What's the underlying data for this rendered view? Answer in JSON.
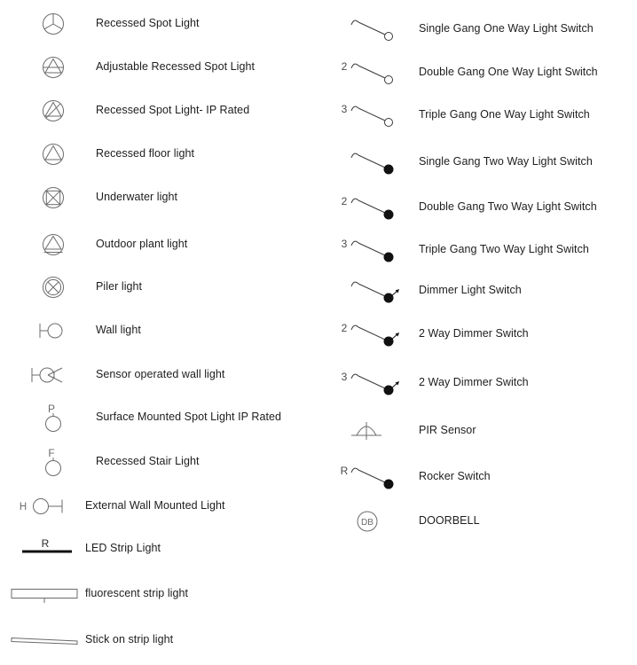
{
  "legend": {
    "left_column": [
      {
        "symbol": "recessed-spot-light",
        "label": "Recessed Spot Light"
      },
      {
        "symbol": "adjustable-recessed-spot-light",
        "label": "Adjustable Recessed Spot Light"
      },
      {
        "symbol": "recessed-spot-light-ip-rated",
        "label": "Recessed Spot Light- IP Rated"
      },
      {
        "symbol": "recessed-floor-light",
        "label": "Recessed floor light"
      },
      {
        "symbol": "underwater-light",
        "label": "Underwater light"
      },
      {
        "symbol": "outdoor-plant-light",
        "label": "Outdoor plant light"
      },
      {
        "symbol": "piler-light",
        "label": "Piler light"
      },
      {
        "symbol": "wall-light",
        "label": "Wall light"
      },
      {
        "symbol": "sensor-operated-wall-light",
        "label": "Sensor operated wall light"
      },
      {
        "symbol": "surface-mounted-spot-light-ip-rated",
        "label": "Surface Mounted Spot Light IP Rated",
        "marker": "P"
      },
      {
        "symbol": "recessed-stair-light",
        "label": "Recessed Stair Light",
        "marker": "F"
      },
      {
        "symbol": "external-wall-mounted-light",
        "label": "External Wall Mounted Light",
        "marker": "H"
      },
      {
        "symbol": "led-strip-light",
        "label": "LED Strip Light",
        "marker": "R"
      },
      {
        "symbol": "fluorescent-strip-light",
        "label": "fluorescent strip light"
      },
      {
        "symbol": "stick-on-strip-light",
        "label": "Stick on strip light"
      }
    ],
    "right_column": [
      {
        "symbol": "single-gang-one-way-switch",
        "label": "Single Gang One Way Light Switch",
        "marker": ""
      },
      {
        "symbol": "double-gang-one-way-switch",
        "label": "Double Gang One Way Light Switch",
        "marker": "2"
      },
      {
        "symbol": "triple-gang-one-way-switch",
        "label": "Triple Gang One Way Light Switch",
        "marker": "3"
      },
      {
        "symbol": "single-gang-two-way-switch",
        "label": "Single Gang Two Way Light Switch",
        "marker": ""
      },
      {
        "symbol": "double-gang-two-way-switch",
        "label": "Double Gang Two Way Light Switch",
        "marker": "2"
      },
      {
        "symbol": "triple-gang-two-way-switch",
        "label": "Triple Gang Two Way Light Switch",
        "marker": "3"
      },
      {
        "symbol": "dimmer-light-switch",
        "label": "Dimmer Light Switch",
        "marker": ""
      },
      {
        "symbol": "two-way-dimmer-switch-2",
        "label": "2 Way Dimmer Switch",
        "marker": "2"
      },
      {
        "symbol": "two-way-dimmer-switch-3",
        "label": "2 Way Dimmer Switch",
        "marker": "3"
      },
      {
        "symbol": "pir-sensor",
        "label": "PIR Sensor"
      },
      {
        "symbol": "rocker-switch",
        "label": "Rocker Switch",
        "marker": "R"
      },
      {
        "symbol": "doorbell",
        "label": "DOORBELL",
        "marker": "DB"
      }
    ],
    "colors": {
      "stroke": "#6b6b6b",
      "stroke_dark": "#111111",
      "text": "#1d1d1d",
      "background": "#ffffff"
    }
  }
}
